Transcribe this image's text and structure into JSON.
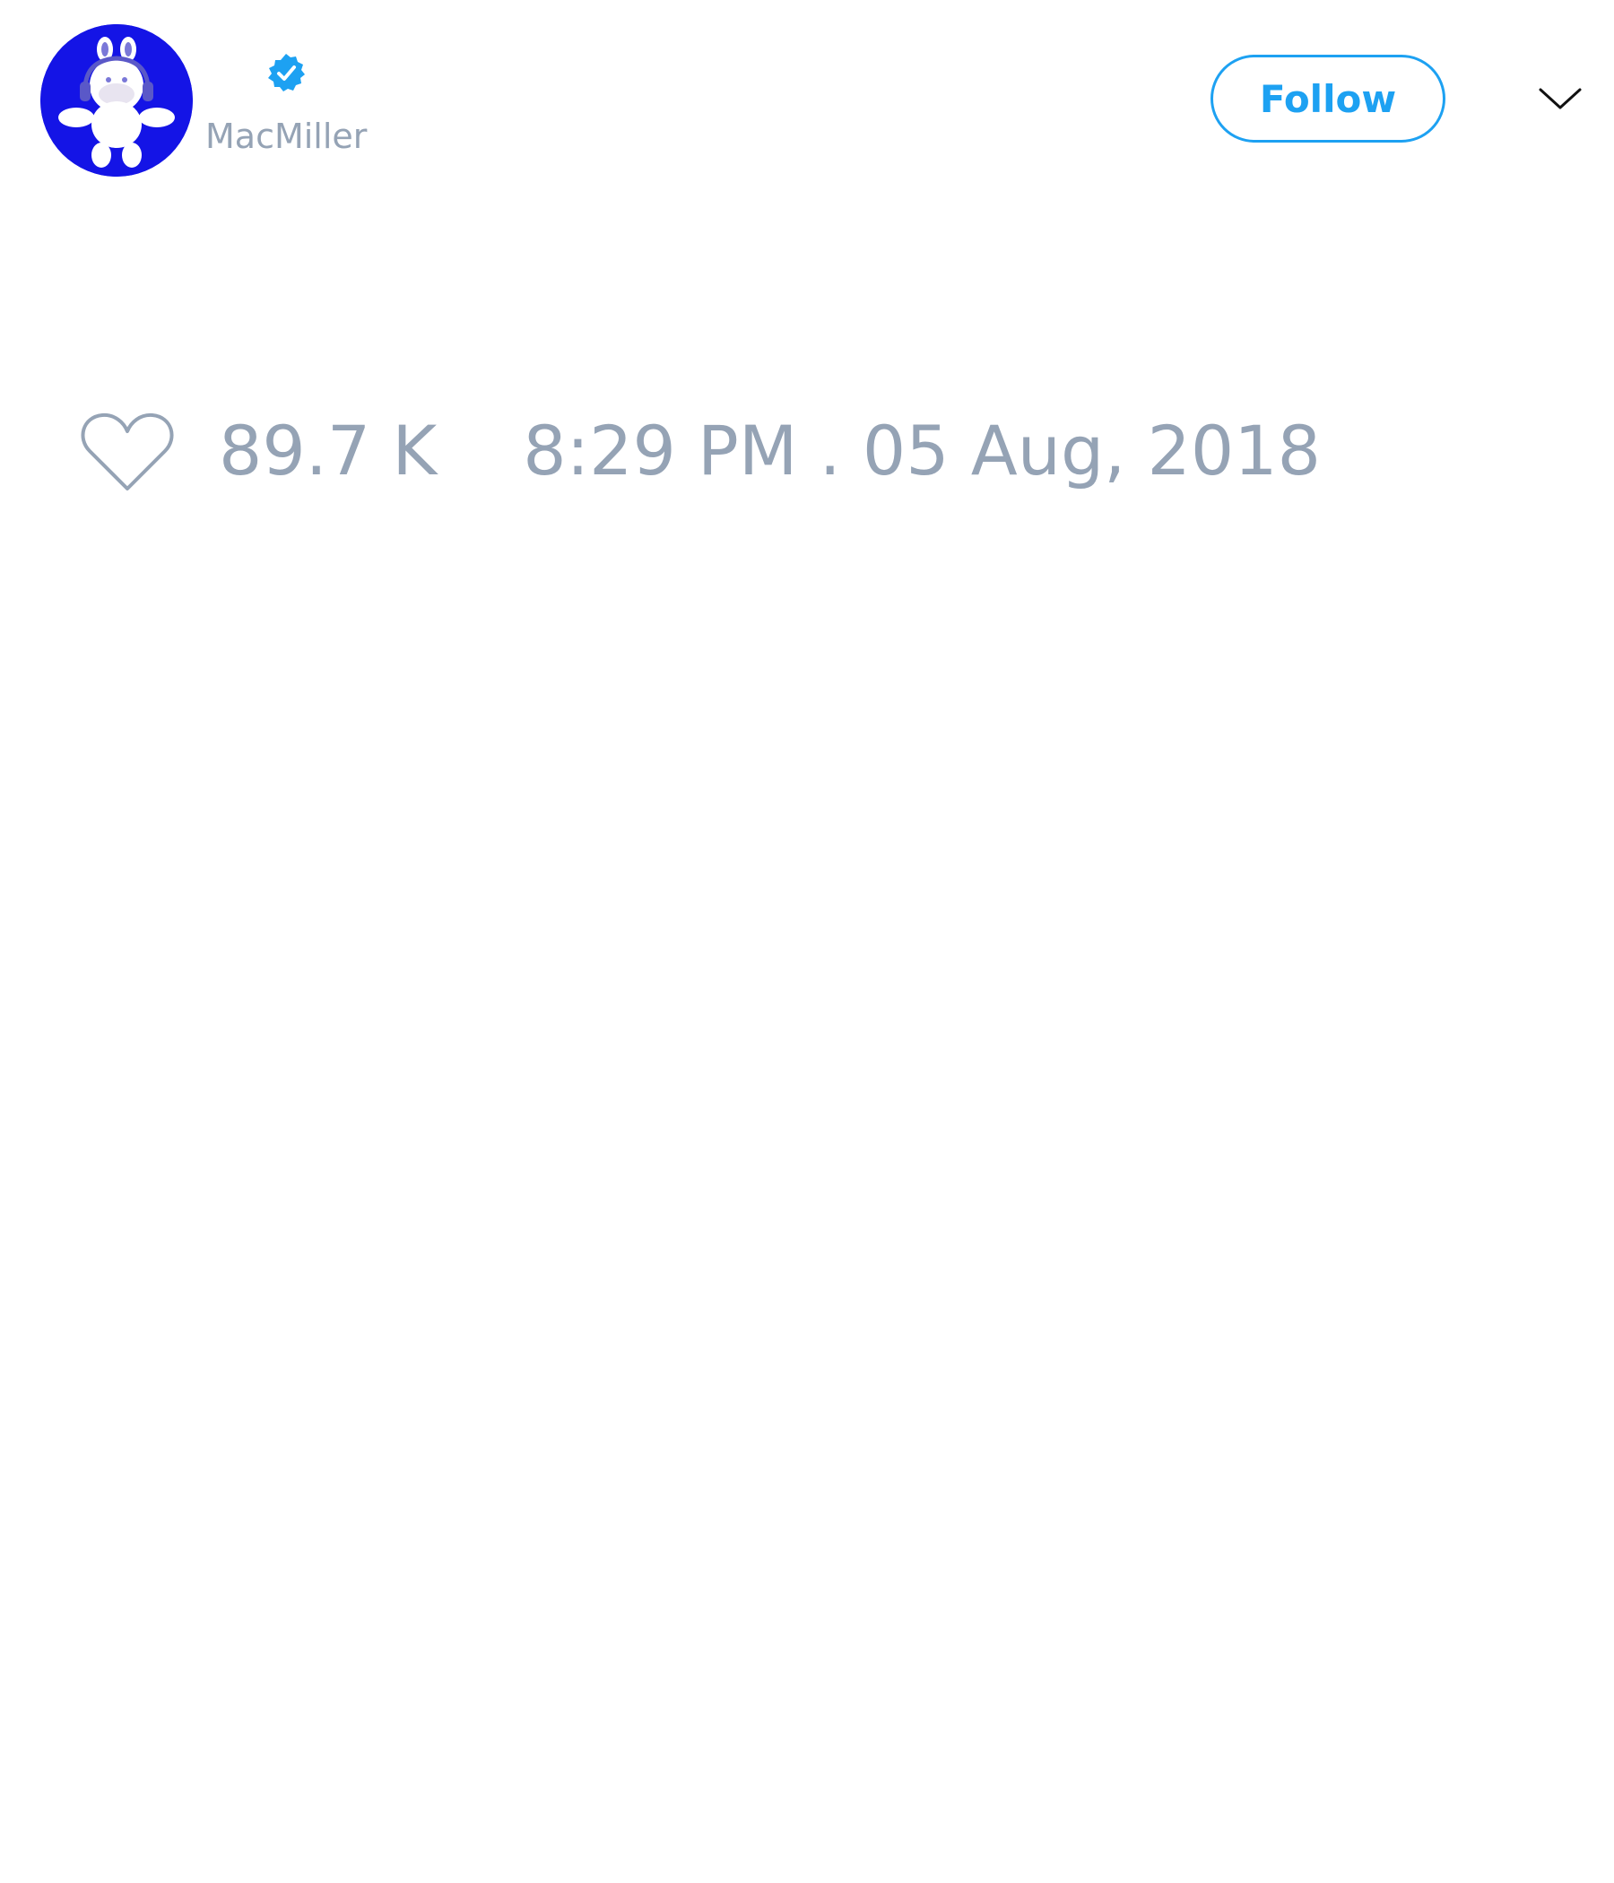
{
  "tweet": {
    "author": {
      "handle": "MacMiller",
      "verified": true,
      "avatar_background": "#1414e6"
    },
    "follow_label": "Follow",
    "likes": "89.7 K",
    "timestamp": "8:29 PM . 05 Aug, 2018"
  },
  "icons": {
    "verified": "verified-badge-icon",
    "menu": "chevron-down-icon",
    "like": "heart-icon"
  },
  "colors": {
    "accent": "#1da1f2",
    "muted_text": "#95a3b5",
    "background": "#ffffff"
  }
}
